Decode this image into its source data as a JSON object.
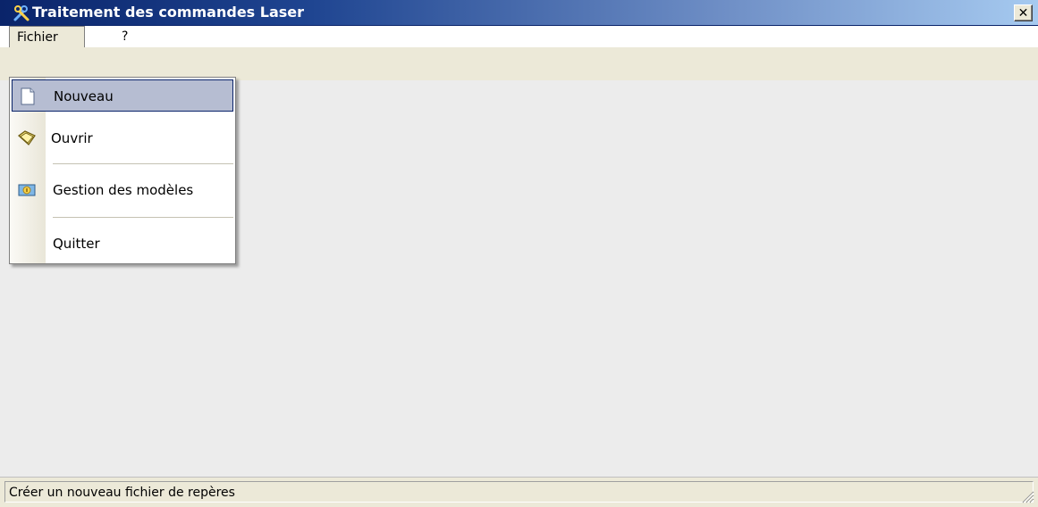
{
  "window": {
    "title": "Traitement des commandes Laser",
    "close_label": "✕"
  },
  "menubar": {
    "items": [
      {
        "label": "Fichier"
      },
      {
        "label": "?"
      }
    ]
  },
  "dropdown": {
    "items": [
      {
        "label": "Nouveau",
        "icon": "new-document-icon",
        "selected": true
      },
      {
        "label": "Ouvrir",
        "icon": "open-folder-icon"
      },
      {
        "label": "Gestion des modèles",
        "icon": "templates-icon"
      },
      {
        "label": "Quitter",
        "icon": null
      }
    ]
  },
  "statusbar": {
    "text": "Créer un nouveau fichier de repères"
  },
  "colors": {
    "title_gradient_start": "#0a246a",
    "title_gradient_end": "#a6caf0",
    "selection": "#b6bdd2",
    "selection_border": "#0a246a"
  }
}
